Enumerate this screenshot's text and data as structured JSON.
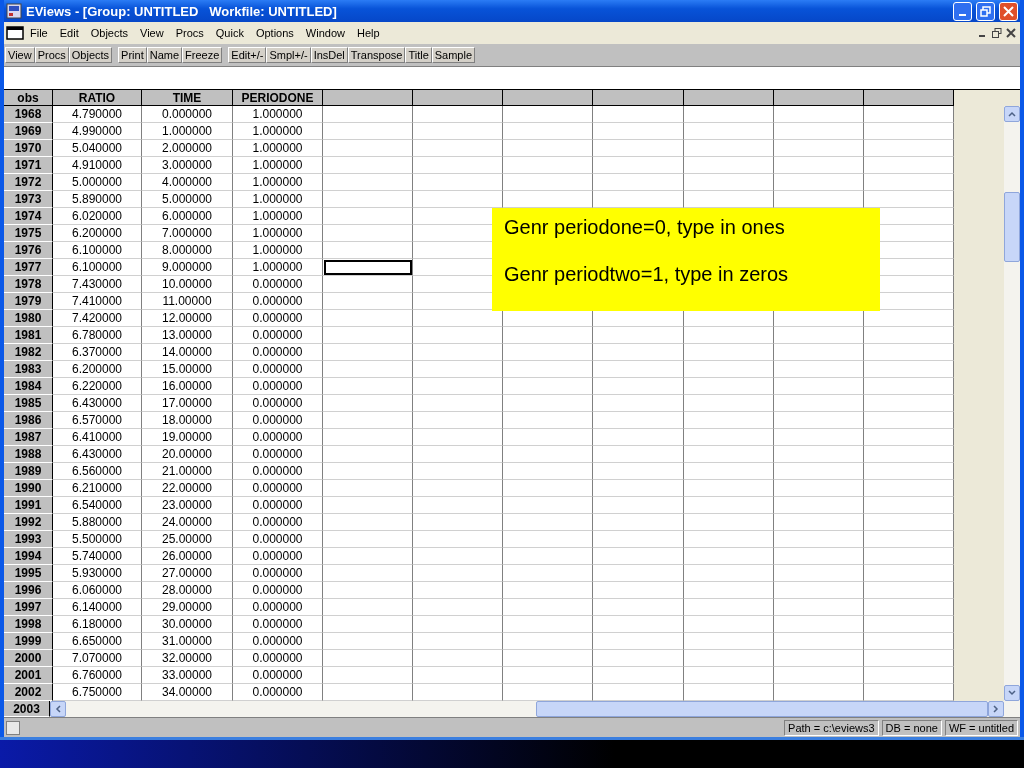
{
  "window": {
    "title": "EViews - [Group: UNTITLED   Workfile: UNTITLED]"
  },
  "menu": [
    "File",
    "Edit",
    "Objects",
    "View",
    "Procs",
    "Quick",
    "Options",
    "Window",
    "Help"
  ],
  "toolbar": [
    [
      "View",
      "Procs",
      "Objects"
    ],
    [
      "Print",
      "Name",
      "Freeze"
    ],
    [
      "Edit+/-",
      "Smpl+/-",
      "InsDel",
      "Transpose",
      "Title",
      "Sample"
    ]
  ],
  "table": {
    "columns": [
      "obs",
      "RATIO",
      "TIME",
      "PERIODONE"
    ],
    "rows": [
      {
        "cells": [
          "1968",
          "4.790000",
          "0.000000",
          "1.000000"
        ],
        "current": false
      },
      {
        "cells": [
          "1969",
          "4.990000",
          "1.000000",
          "1.000000"
        ],
        "current": false
      },
      {
        "cells": [
          "1970",
          "5.040000",
          "2.000000",
          "1.000000"
        ],
        "current": false
      },
      {
        "cells": [
          "1971",
          "4.910000",
          "3.000000",
          "1.000000"
        ],
        "current": false
      },
      {
        "cells": [
          "1972",
          "5.000000",
          "4.000000",
          "1.000000"
        ],
        "current": false
      },
      {
        "cells": [
          "1973",
          "5.890000",
          "5.000000",
          "1.000000"
        ],
        "current": false
      },
      {
        "cells": [
          "1974",
          "6.020000",
          "6.000000",
          "1.000000"
        ],
        "current": false
      },
      {
        "cells": [
          "1975",
          "6.200000",
          "7.000000",
          "1.000000"
        ],
        "current": false
      },
      {
        "cells": [
          "1976",
          "6.100000",
          "8.000000",
          "1.000000"
        ],
        "current": false
      },
      {
        "cells": [
          "1977",
          "6.100000",
          "9.000000",
          "1.000000"
        ],
        "current": true
      },
      {
        "cells": [
          "1978",
          "7.430000",
          "10.00000",
          "0.000000"
        ],
        "current": false
      },
      {
        "cells": [
          "1979",
          "7.410000",
          "11.00000",
          "0.000000"
        ],
        "current": false
      },
      {
        "cells": [
          "1980",
          "7.420000",
          "12.00000",
          "0.000000"
        ],
        "current": false
      },
      {
        "cells": [
          "1981",
          "6.780000",
          "13.00000",
          "0.000000"
        ],
        "current": false
      },
      {
        "cells": [
          "1982",
          "6.370000",
          "14.00000",
          "0.000000"
        ],
        "current": false
      },
      {
        "cells": [
          "1983",
          "6.200000",
          "15.00000",
          "0.000000"
        ],
        "current": false
      },
      {
        "cells": [
          "1984",
          "6.220000",
          "16.00000",
          "0.000000"
        ],
        "current": false
      },
      {
        "cells": [
          "1985",
          "6.430000",
          "17.00000",
          "0.000000"
        ],
        "current": false
      },
      {
        "cells": [
          "1986",
          "6.570000",
          "18.00000",
          "0.000000"
        ],
        "current": false
      },
      {
        "cells": [
          "1987",
          "6.410000",
          "19.00000",
          "0.000000"
        ],
        "current": false
      },
      {
        "cells": [
          "1988",
          "6.430000",
          "20.00000",
          "0.000000"
        ],
        "current": false
      },
      {
        "cells": [
          "1989",
          "6.560000",
          "21.00000",
          "0.000000"
        ],
        "current": false
      },
      {
        "cells": [
          "1990",
          "6.210000",
          "22.00000",
          "0.000000"
        ],
        "current": false
      },
      {
        "cells": [
          "1991",
          "6.540000",
          "23.00000",
          "0.000000"
        ],
        "current": false
      },
      {
        "cells": [
          "1992",
          "5.880000",
          "24.00000",
          "0.000000"
        ],
        "current": false
      },
      {
        "cells": [
          "1993",
          "5.500000",
          "25.00000",
          "0.000000"
        ],
        "current": false
      },
      {
        "cells": [
          "1994",
          "5.740000",
          "26.00000",
          "0.000000"
        ],
        "current": false
      },
      {
        "cells": [
          "1995",
          "5.930000",
          "27.00000",
          "0.000000"
        ],
        "current": false
      },
      {
        "cells": [
          "1996",
          "6.060000",
          "28.00000",
          "0.000000"
        ],
        "current": false
      },
      {
        "cells": [
          "1997",
          "6.140000",
          "29.00000",
          "0.000000"
        ],
        "current": false
      },
      {
        "cells": [
          "1998",
          "6.180000",
          "30.00000",
          "0.000000"
        ],
        "current": false
      },
      {
        "cells": [
          "1999",
          "6.650000",
          "31.00000",
          "0.000000"
        ],
        "current": false
      },
      {
        "cells": [
          "2000",
          "7.070000",
          "32.00000",
          "0.000000"
        ],
        "current": false
      },
      {
        "cells": [
          "2001",
          "6.760000",
          "33.00000",
          "0.000000"
        ],
        "current": false
      },
      {
        "cells": [
          "2002",
          "6.750000",
          "34.00000",
          "0.000000"
        ],
        "current": false
      }
    ],
    "last_row_obs": "2003"
  },
  "callout": [
    "Genr  periodone=0, type in ones",
    "Genr periodtwo=1, type in zeros"
  ],
  "status_bar": [
    "Path = c:\\eviews3",
    "DB = none",
    "WF = untitled"
  ]
}
